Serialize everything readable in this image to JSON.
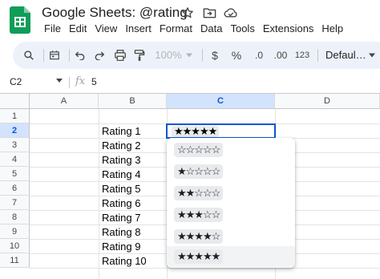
{
  "app": {
    "title": "Google Sheets: @rating",
    "brand_color": "#0f9d58",
    "title_icons": [
      "star-icon",
      "move-folder-icon",
      "cloud-saved-icon"
    ]
  },
  "menu": [
    "File",
    "Edit",
    "View",
    "Insert",
    "Format",
    "Data",
    "Tools",
    "Extensions",
    "Help"
  ],
  "toolbar": {
    "zoom": "100%",
    "currency": "$",
    "percent": "%",
    "decrease_decimals": ".0",
    "increase_decimals": ".00",
    "more_formats": "123",
    "font": "Defaul…"
  },
  "formula_bar": {
    "name_box": "C2",
    "fx": "fx",
    "value": "5"
  },
  "grid": {
    "columns": [
      "A",
      "B",
      "C",
      "D"
    ],
    "selected_column": "C",
    "rows": [
      "1",
      "2",
      "3",
      "4",
      "5",
      "6",
      "7",
      "8",
      "9",
      "10",
      "11"
    ],
    "selected_row": "2",
    "column_b": [
      "",
      "Rating 1",
      "Rating 2",
      "Rating 3",
      "Rating 4",
      "Rating 5",
      "Rating 6",
      "Rating 7",
      "Rating 8",
      "Rating 9",
      "Rating 10"
    ],
    "active_cell": {
      "ref": "C2",
      "display": "★★★★★",
      "rating": 5,
      "max_rating": 5
    }
  },
  "dropdown": {
    "options": [
      {
        "display": "☆☆☆☆☆",
        "rating": 0
      },
      {
        "display": "★☆☆☆☆",
        "rating": 1
      },
      {
        "display": "★★☆☆☆",
        "rating": 2
      },
      {
        "display": "★★★☆☆",
        "rating": 3
      },
      {
        "display": "★★★★☆",
        "rating": 4
      },
      {
        "display": "★★★★★",
        "rating": 5
      }
    ],
    "highlighted_index": 5
  }
}
